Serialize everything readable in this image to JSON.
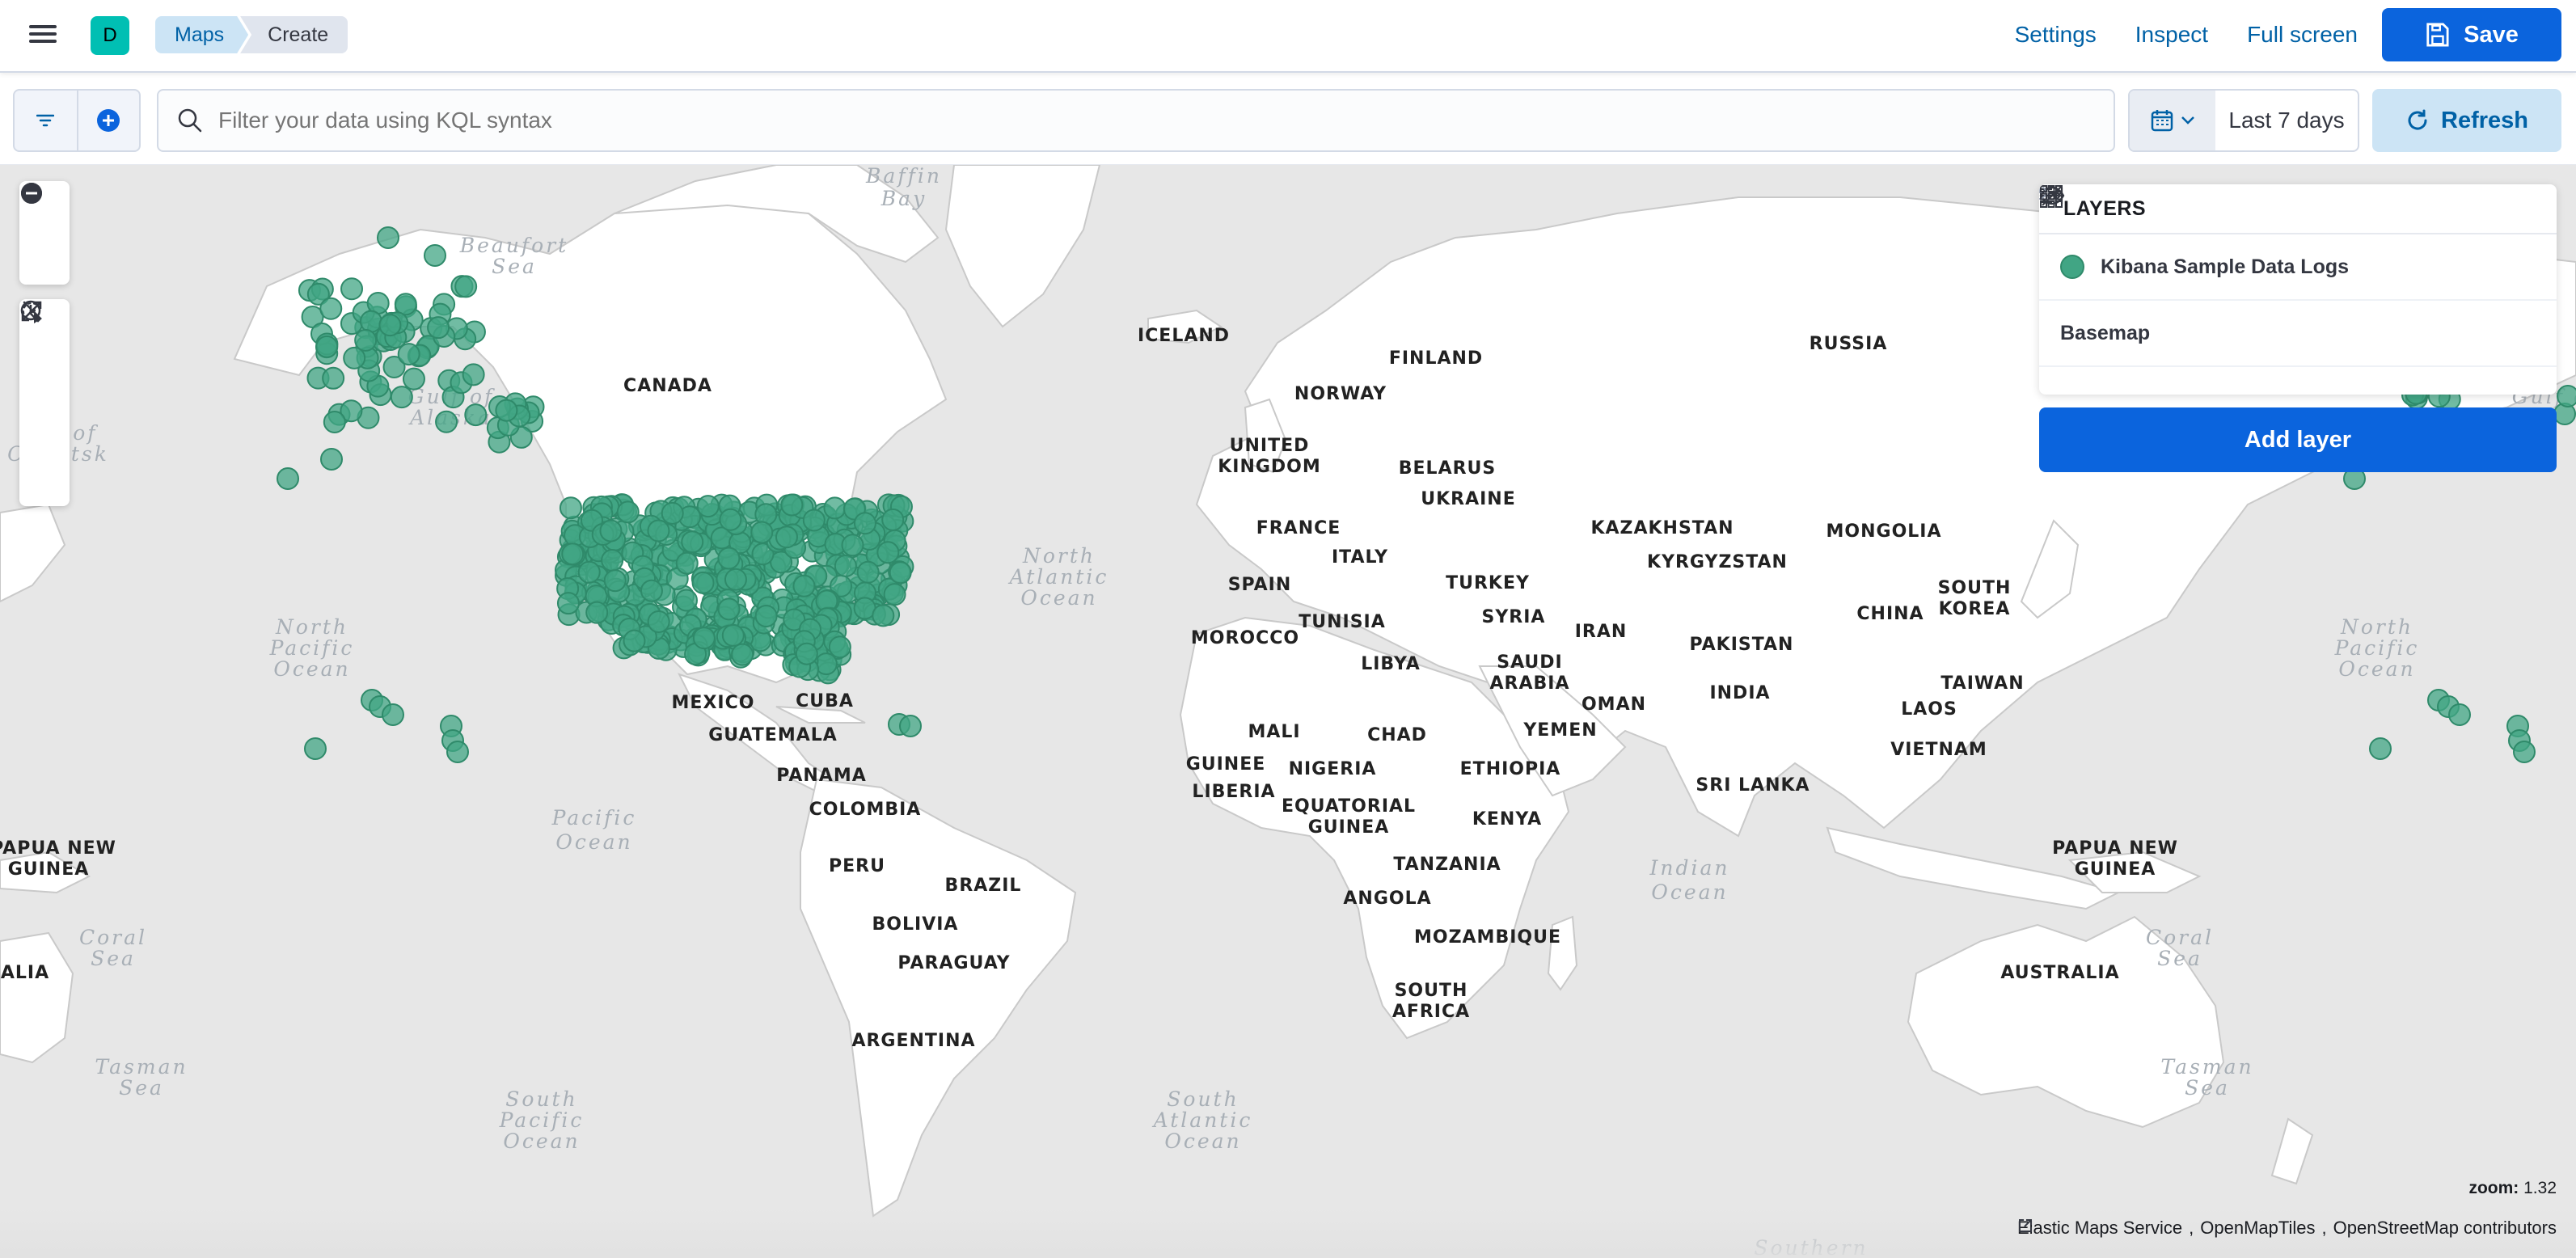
{
  "header": {
    "space_initial": "D",
    "breadcrumbs": [
      "Maps",
      "Create"
    ],
    "links": {
      "settings": "Settings",
      "inspect": "Inspect",
      "full_screen": "Full screen"
    },
    "save_label": "Save"
  },
  "querybar": {
    "search_placeholder": "Filter your data using KQL syntax",
    "date_range": "Last 7 days",
    "refresh_label": "Refresh"
  },
  "map": {
    "layers_title": "LAYERS",
    "layers": [
      {
        "name": "Kibana Sample Data Logs",
        "type": "documents",
        "color": "#41a584"
      },
      {
        "name": "Basemap",
        "type": "tiles"
      }
    ],
    "add_layer_label": "Add layer",
    "zoom_label": "zoom:",
    "zoom_value": "1.32",
    "attributions": [
      "Elastic Maps Service",
      "OpenMapTiles",
      "OpenStreetMap contributors"
    ],
    "ocean_labels": [
      {
        "text": "Baffin",
        "ref": "baffin1"
      },
      {
        "text": "Bay",
        "ref": "baffin2"
      },
      {
        "text": "Beaufort",
        "ref": "beau1"
      },
      {
        "text": "Sea",
        "ref": "beau2"
      },
      {
        "text": "Gulf of",
        "ref": "alaska1"
      },
      {
        "text": "Alaska",
        "ref": "alaska2"
      },
      {
        "text": "North",
        "ref": "npac1"
      },
      {
        "text": "Pacific",
        "ref": "npac2"
      },
      {
        "text": "Ocean",
        "ref": "npac3"
      },
      {
        "text": "North",
        "ref": "natl1"
      },
      {
        "text": "Atlantic",
        "ref": "natl2"
      },
      {
        "text": "Ocean",
        "ref": "natl3"
      },
      {
        "text": "Pacific",
        "ref": "pac1"
      },
      {
        "text": "Ocean",
        "ref": "pac2"
      },
      {
        "text": "Indian",
        "ref": "ind1"
      },
      {
        "text": "Ocean",
        "ref": "ind2"
      },
      {
        "text": "South",
        "ref": "spac1"
      },
      {
        "text": "Pacific",
        "ref": "spac2"
      },
      {
        "text": "Ocean",
        "ref": "spac3"
      },
      {
        "text": "South",
        "ref": "satl1"
      },
      {
        "text": "Atlantic",
        "ref": "satl2"
      },
      {
        "text": "Ocean",
        "ref": "satl3"
      },
      {
        "text": "Coral",
        "ref": "coral1"
      },
      {
        "text": "Sea",
        "ref": "coral2"
      },
      {
        "text": "Tasman",
        "ref": "tas1"
      },
      {
        "text": "Sea",
        "ref": "tas2"
      },
      {
        "text": "North",
        "ref": "npac4"
      },
      {
        "text": "Pacific",
        "ref": "npac5"
      },
      {
        "text": "Ocean",
        "ref": "npac6"
      },
      {
        "text": "Coral",
        "ref": "coral3"
      },
      {
        "text": "Sea",
        "ref": "coral4"
      },
      {
        "text": "Tasman",
        "ref": "tas3"
      },
      {
        "text": "Sea",
        "ref": "tas4"
      },
      {
        "text": "Sea of",
        "ref": "okh1"
      },
      {
        "text": "Okhotsk",
        "ref": "okh2"
      },
      {
        "text": "Gulf of",
        "ref": "alaska3"
      },
      {
        "text": "Southern",
        "ref": "south1"
      }
    ],
    "country_labels": [
      "CANADA",
      "ICELAND",
      "FINLAND",
      "NORWAY",
      "RUSSIA",
      "UNITED",
      "KINGDOM",
      "BELARUS",
      "UKRAINE",
      "FRANCE",
      "ITALY",
      "SPAIN",
      "KAZAKHSTAN",
      "MONGOLIA",
      "KYRGYZSTAN",
      "TURKEY",
      "SYRIA",
      "IRAN",
      "TUNISIA",
      "MOROCCO",
      "LIBYA",
      "SAUDI",
      "ARABIA",
      "OMAN",
      "YEMEN",
      "PAKISTAN",
      "INDIA",
      "CHINA",
      "SOUTH",
      "KOREA",
      "TAIWAN",
      "LAOS",
      "VIETNAM",
      "SRI LANKA",
      "MALI",
      "CHAD",
      "NIGERIA",
      "ETHIOPIA",
      "GUINEE",
      "LIBERIA",
      "EQUATORIAL",
      "GUINEA",
      "KENYA",
      "TANZANIA",
      "ANGOLA",
      "MOZAMBIQUE",
      "SOUTH",
      "AFRICA",
      "MEXICO",
      "CUBA",
      "GUATEMALA",
      "PANAMA",
      "COLOMBIA",
      "PERU",
      "BRAZIL",
      "BOLIVIA",
      "PARAGUAY",
      "ARGENTINA",
      "PAPUA NEW",
      "GUINEA",
      "PAPUA NEW",
      "GUINEA",
      "AUSTRALIA",
      "RALIA"
    ]
  }
}
